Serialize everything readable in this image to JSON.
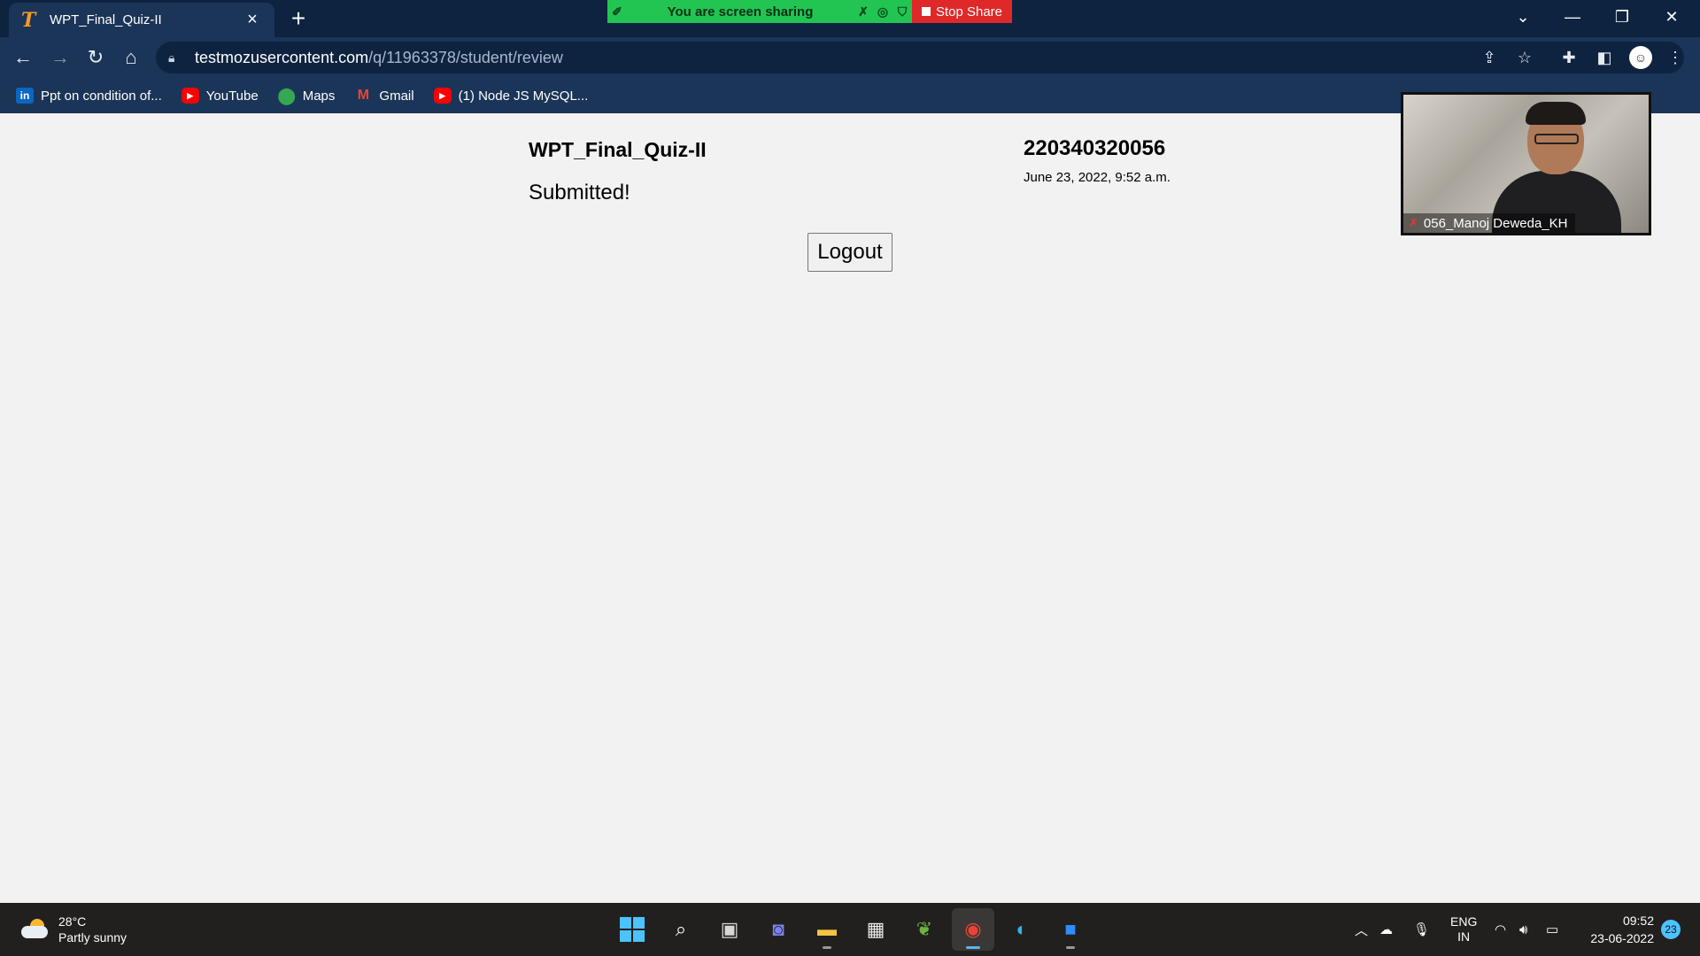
{
  "browser": {
    "tab": {
      "title": "WPT_Final_Quiz-II",
      "favicon": "T",
      "close": "×"
    },
    "new_tab": "+",
    "window_controls": {
      "tab_search": "⌄",
      "minimize": "—",
      "restore": "❐",
      "close": "✕"
    },
    "url_host": "testmozusercontent.com",
    "url_path": "/q/11963378/student/review",
    "bookmarks": [
      {
        "label": "Ppt on condition of...",
        "icon": "linkedin-icon",
        "glyph": "in"
      },
      {
        "label": "YouTube",
        "icon": "youtube-icon",
        "glyph": "▶"
      },
      {
        "label": "Maps",
        "icon": "maps-icon",
        "glyph": "⬤"
      },
      {
        "label": "Gmail",
        "icon": "gmail-icon",
        "glyph": "M"
      },
      {
        "label": "(1) Node JS MySQL...",
        "icon": "youtube-icon",
        "glyph": "▶"
      }
    ]
  },
  "share_bar": {
    "text": "You are screen sharing",
    "stop_label": "Stop Share"
  },
  "page": {
    "quiz_name": "WPT_Final_Quiz-II",
    "status": "Submitted!",
    "student_id": "220340320056",
    "submitted_at": "June 23, 2022, 9:52 a.m.",
    "logout_label": "Logout"
  },
  "video": {
    "participant_name": "056_Manoj Deweda_KH"
  },
  "taskbar": {
    "weather_temp": "28°C",
    "weather_desc": "Partly sunny",
    "language_line1": "ENG",
    "language_line2": "IN",
    "time": "09:52",
    "date": "23-06-2022",
    "notification_count": "23"
  },
  "colors": {
    "tabstrip": "#0e2340",
    "toolbar": "#1b3558",
    "share_green": "#23c552",
    "stop_red": "#e02828",
    "page_bg": "#f2f2f2",
    "taskbar": "#22201e"
  }
}
